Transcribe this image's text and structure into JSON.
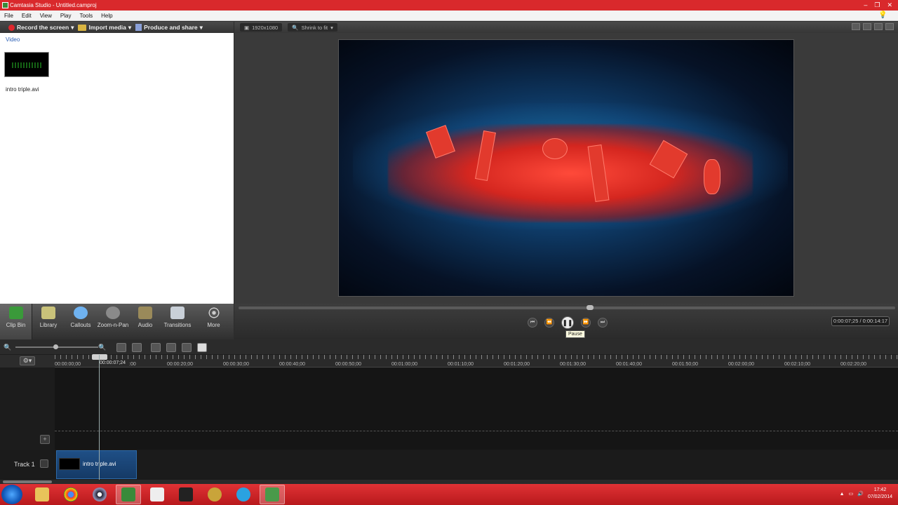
{
  "window": {
    "title": "Camtasia Studio - Untitled.camproj",
    "controls": [
      "–",
      "❐",
      "✕"
    ]
  },
  "menu": [
    "File",
    "Edit",
    "View",
    "Play",
    "Tools",
    "Help"
  ],
  "toolbar": {
    "record": "Record the screen",
    "import": "Import media",
    "produce": "Produce and share"
  },
  "clip_bin": {
    "section": "Video",
    "clip_name": "intro triple.avi"
  },
  "preview_toolbar": {
    "resolution": "1920x1080",
    "zoom": "Shrink to fit"
  },
  "tabs": [
    {
      "label": "Clip Bin"
    },
    {
      "label": "Library"
    },
    {
      "label": "Callouts"
    },
    {
      "label": "Zoom-n-Pan"
    },
    {
      "label": "Audio"
    },
    {
      "label": "Transitions"
    },
    {
      "label": "More"
    }
  ],
  "player": {
    "tooltip": "Pause",
    "time": "0:00:07;25 / 0:00:14:17",
    "progress": 0.53
  },
  "timeline": {
    "playhead_label": "00:00:07;24",
    "ticks": [
      "00:00:00;00",
      ":00",
      "00:00:20;00",
      "00:00:30;00",
      "00:00:40;00",
      "00:00:50;00",
      "00:01:00;00",
      "00:01:10;00",
      "00:01:20;00",
      "00:01:30;00",
      "00:01:40;00",
      "00:01:50;00",
      "00:02:00;00",
      "00:02:10;00",
      "00:02:20;00"
    ],
    "track_label": "Track 1",
    "clip_name": "intro triple.avi"
  },
  "taskbar": {
    "time": "17:42",
    "date": "07/02/2014"
  }
}
